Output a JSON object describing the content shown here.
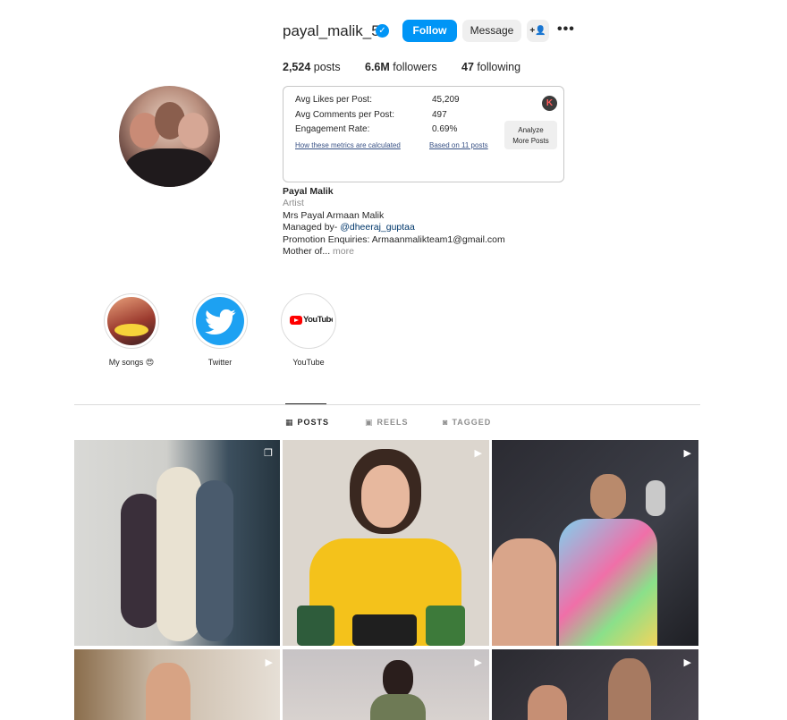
{
  "profile": {
    "username": "payal_malik_53",
    "verified_glyph": "✓",
    "follow_label": "Follow",
    "message_label": "Message",
    "add_user_glyph": "+👤",
    "more_glyph": "•••"
  },
  "stats": {
    "posts_value": "2,524",
    "posts_label": "posts",
    "followers_value": "6.6M",
    "followers_label": "followers",
    "following_value": "47",
    "following_label": "following"
  },
  "metrics": {
    "avg_likes_label": "Avg Likes per Post:",
    "avg_likes_value": "45,209",
    "avg_comments_label": "Avg Comments per Post:",
    "avg_comments_value": "497",
    "engagement_label": "Engagement Rate:",
    "engagement_value": "0.69%",
    "how_link": "How these metrics are calculated",
    "based_link": "Based on 11 posts",
    "logo_letter": "K",
    "analyze_line1": "Analyze",
    "analyze_line2": "More Posts"
  },
  "bio": {
    "name": "Payal Malik",
    "category": "Artist",
    "line1": "Mrs Payal Armaan Malik",
    "managed_prefix": "Managed by- ",
    "managed_tag": "@dheeraj_guptaa",
    "line3": "Promotion Enquiries: Armaanmalikteam1@gmail.com",
    "line4": "Mother of...",
    "more": " more"
  },
  "highlights": [
    {
      "label": "My songs 😍"
    },
    {
      "label": "Twitter"
    },
    {
      "label": "YouTube",
      "logo_text": "YouTube"
    }
  ],
  "tabs": [
    {
      "label": "POSTS",
      "icon": "▦",
      "active": true
    },
    {
      "label": "REELS",
      "icon": "▣",
      "active": false
    },
    {
      "label": "TAGGED",
      "icon": "◙",
      "active": false
    }
  ],
  "colors": {
    "accent": "#0095f6",
    "link": "#00376b"
  },
  "post_badges": [
    "❐",
    "▶",
    "▶",
    "▶",
    "▶",
    "▶"
  ]
}
